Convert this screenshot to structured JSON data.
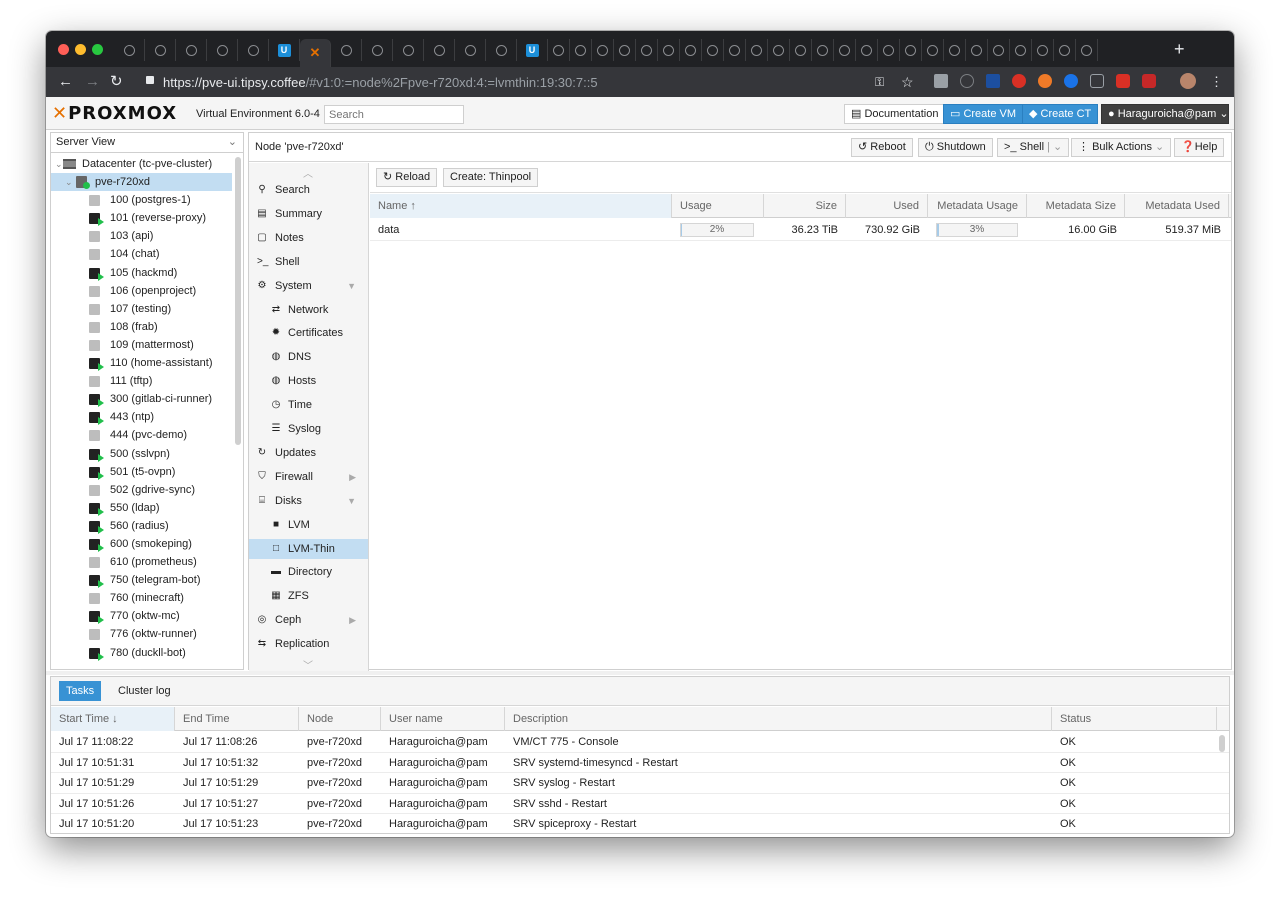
{
  "browser": {
    "url_host": "https://pve-ui.tipsy.coffee",
    "url_path": "/#v1:0:=node%2Fpve-r720xd:4:=lvmthin:19:30:7::5",
    "new_tab": "+"
  },
  "header": {
    "logo": "PROXMOX",
    "version": "Virtual Environment 6.0-4",
    "search_placeholder": "Search",
    "documentation": "Documentation",
    "create_vm": "Create VM",
    "create_ct": "Create CT",
    "user": "Haraguroicha@pam"
  },
  "tree": {
    "view": "Server View",
    "datacenter": "Datacenter (tc-pve-cluster)",
    "node": "pve-r720xd",
    "guests": [
      {
        "label": "100 (postgres-1)",
        "running": false
      },
      {
        "label": "101 (reverse-proxy)",
        "running": true
      },
      {
        "label": "103 (api)",
        "running": false
      },
      {
        "label": "104 (chat)",
        "running": false
      },
      {
        "label": "105 (hackmd)",
        "running": true
      },
      {
        "label": "106 (openproject)",
        "running": false
      },
      {
        "label": "107 (testing)",
        "running": false
      },
      {
        "label": "108 (frab)",
        "running": false
      },
      {
        "label": "109 (mattermost)",
        "running": false
      },
      {
        "label": "110 (home-assistant)",
        "running": true
      },
      {
        "label": "111 (tftp)",
        "running": false
      },
      {
        "label": "300 (gitlab-ci-runner)",
        "running": true
      },
      {
        "label": "443 (ntp)",
        "running": true
      },
      {
        "label": "444 (pvc-demo)",
        "running": false
      },
      {
        "label": "500 (sslvpn)",
        "running": true
      },
      {
        "label": "501 (t5-ovpn)",
        "running": true
      },
      {
        "label": "502 (gdrive-sync)",
        "running": false
      },
      {
        "label": "550 (ldap)",
        "running": true
      },
      {
        "label": "560 (radius)",
        "running": true
      },
      {
        "label": "600 (smokeping)",
        "running": true
      },
      {
        "label": "610 (prometheus)",
        "running": false
      },
      {
        "label": "750 (telegram-bot)",
        "running": true
      },
      {
        "label": "760 (minecraft)",
        "running": false
      },
      {
        "label": "770 (oktw-mc)",
        "running": true
      },
      {
        "label": "776 (oktw-runner)",
        "running": false
      },
      {
        "label": "780 (duckll-bot)",
        "running": true
      }
    ]
  },
  "node_bar": {
    "title": "Node 'pve-r720xd'",
    "reboot": "Reboot",
    "shutdown": "Shutdown",
    "shell": "Shell",
    "bulk": "Bulk Actions",
    "help": "Help"
  },
  "nav": {
    "items": [
      {
        "label": "Search",
        "icon": "search-icon",
        "glyph": "⚲",
        "child": false
      },
      {
        "label": "Summary",
        "icon": "book-icon",
        "glyph": "▤",
        "child": false
      },
      {
        "label": "Notes",
        "icon": "notes-icon",
        "glyph": "▢",
        "child": false
      },
      {
        "label": "Shell",
        "icon": "terminal-icon",
        "glyph": ">_",
        "child": false
      },
      {
        "label": "System",
        "icon": "cogs-icon",
        "glyph": "⚙",
        "child": false,
        "arrow": "▼"
      },
      {
        "label": "Network",
        "icon": "exchange-icon",
        "glyph": "⇄",
        "child": true
      },
      {
        "label": "Certificates",
        "icon": "certificate-icon",
        "glyph": "✹",
        "child": true
      },
      {
        "label": "DNS",
        "icon": "globe-icon",
        "glyph": "◍",
        "child": true
      },
      {
        "label": "Hosts",
        "icon": "globe-icon",
        "glyph": "◍",
        "child": true
      },
      {
        "label": "Time",
        "icon": "clock-icon",
        "glyph": "◷",
        "child": true
      },
      {
        "label": "Syslog",
        "icon": "list-icon",
        "glyph": "☰",
        "child": true
      },
      {
        "label": "Updates",
        "icon": "refresh-icon",
        "glyph": "↻",
        "child": false
      },
      {
        "label": "Firewall",
        "icon": "shield-icon",
        "glyph": "⛉",
        "child": false,
        "arrow": "▶"
      },
      {
        "label": "Disks",
        "icon": "hdd-icon",
        "glyph": "⌸",
        "child": false,
        "arrow": "▼"
      },
      {
        "label": "LVM",
        "icon": "square-icon",
        "glyph": "■",
        "child": true
      },
      {
        "label": "LVM-Thin",
        "icon": "square-outline-icon",
        "glyph": "□",
        "child": true,
        "selected": true
      },
      {
        "label": "Directory",
        "icon": "folder-icon",
        "glyph": "▬",
        "child": true
      },
      {
        "label": "ZFS",
        "icon": "grid-icon",
        "glyph": "▦",
        "child": true
      },
      {
        "label": "Ceph",
        "icon": "ceph-icon",
        "glyph": "◎",
        "child": false,
        "arrow": "▶"
      },
      {
        "label": "Replication",
        "icon": "retweet-icon",
        "glyph": "⇆",
        "child": false
      }
    ]
  },
  "content_toolbar": {
    "reload": "Reload",
    "create_thinpool": "Create: Thinpool"
  },
  "thinpool_grid": {
    "columns": [
      "Name",
      "Usage",
      "Size",
      "Used",
      "Metadata Usage",
      "Metadata Size",
      "Metadata Used"
    ],
    "rows": [
      {
        "name": "data",
        "usage": "2%",
        "usage_fraction": 0.02,
        "size": "36.23 TiB",
        "used": "730.92 GiB",
        "metadata_usage": "3%",
        "metadata_fraction": 0.03,
        "metadata_size": "16.00 GiB",
        "metadata_used": "519.37 MiB"
      }
    ]
  },
  "tasks": {
    "tabs": [
      "Tasks",
      "Cluster log"
    ],
    "columns": [
      "Start Time",
      "End Time",
      "Node",
      "User name",
      "Description",
      "Status"
    ],
    "rows": [
      {
        "start": "Jul 17 11:08:22",
        "end": "Jul 17 11:08:26",
        "node": "pve-r720xd",
        "user": "Haraguroicha@pam",
        "desc": "VM/CT 775 - Console",
        "status": "OK"
      },
      {
        "start": "Jul 17 10:51:31",
        "end": "Jul 17 10:51:32",
        "node": "pve-r720xd",
        "user": "Haraguroicha@pam",
        "desc": "SRV systemd-timesyncd - Restart",
        "status": "OK"
      },
      {
        "start": "Jul 17 10:51:29",
        "end": "Jul 17 10:51:29",
        "node": "pve-r720xd",
        "user": "Haraguroicha@pam",
        "desc": "SRV syslog - Restart",
        "status": "OK"
      },
      {
        "start": "Jul 17 10:51:26",
        "end": "Jul 17 10:51:27",
        "node": "pve-r720xd",
        "user": "Haraguroicha@pam",
        "desc": "SRV sshd - Restart",
        "status": "OK"
      },
      {
        "start": "Jul 17 10:51:20",
        "end": "Jul 17 10:51:23",
        "node": "pve-r720xd",
        "user": "Haraguroicha@pam",
        "desc": "SRV spiceproxy - Restart",
        "status": "OK"
      }
    ]
  },
  "colors": {
    "accent": "#3892d4",
    "selection": "#c2ddf2",
    "brand": "#e57000",
    "running": "#21bf4b"
  }
}
